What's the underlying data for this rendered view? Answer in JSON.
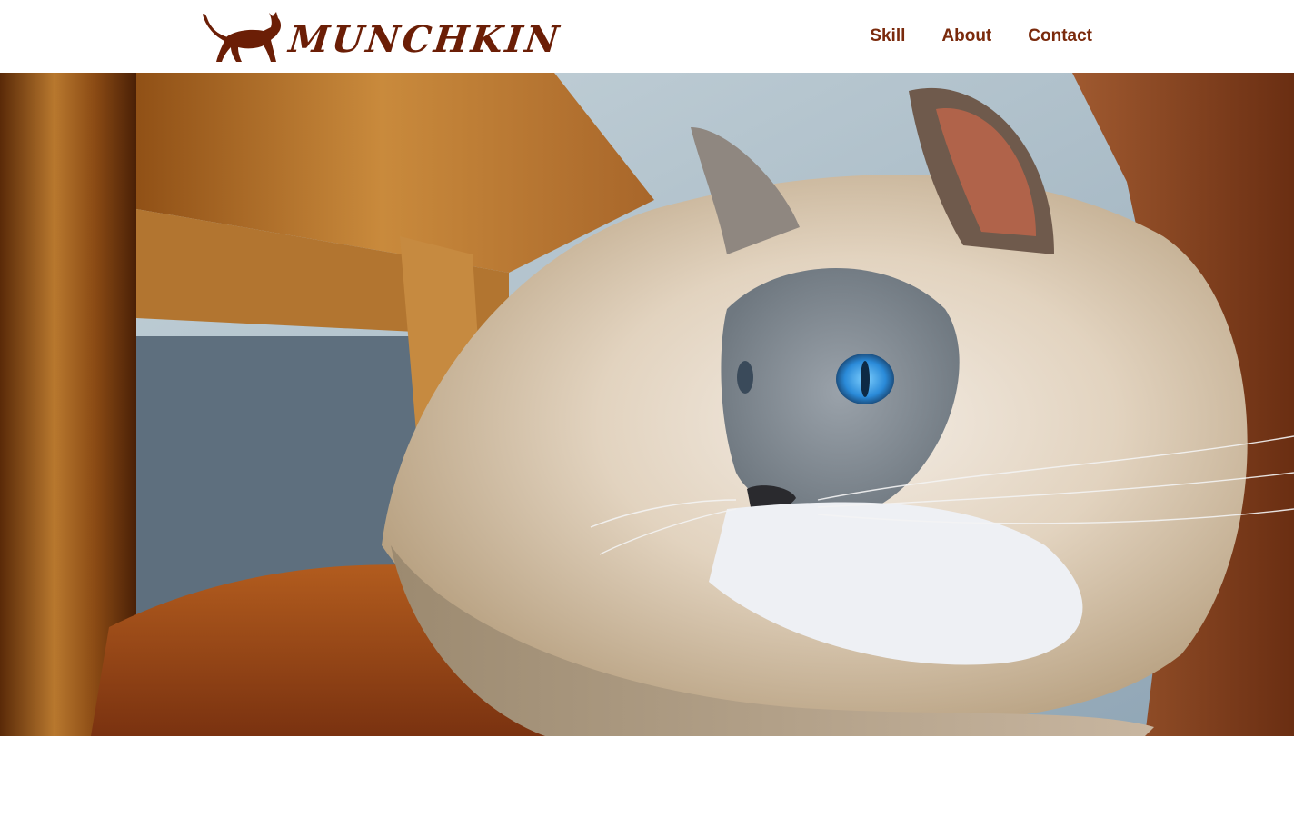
{
  "header": {
    "logo_text": "MUNCHKIN",
    "logo_icon": "cat-silhouette-icon",
    "brand_color": "#6b1e06"
  },
  "nav": {
    "items": [
      {
        "label": "Skill"
      },
      {
        "label": "About"
      },
      {
        "label": "Contact"
      }
    ]
  },
  "hero": {
    "image": "hero-cat-photo"
  }
}
